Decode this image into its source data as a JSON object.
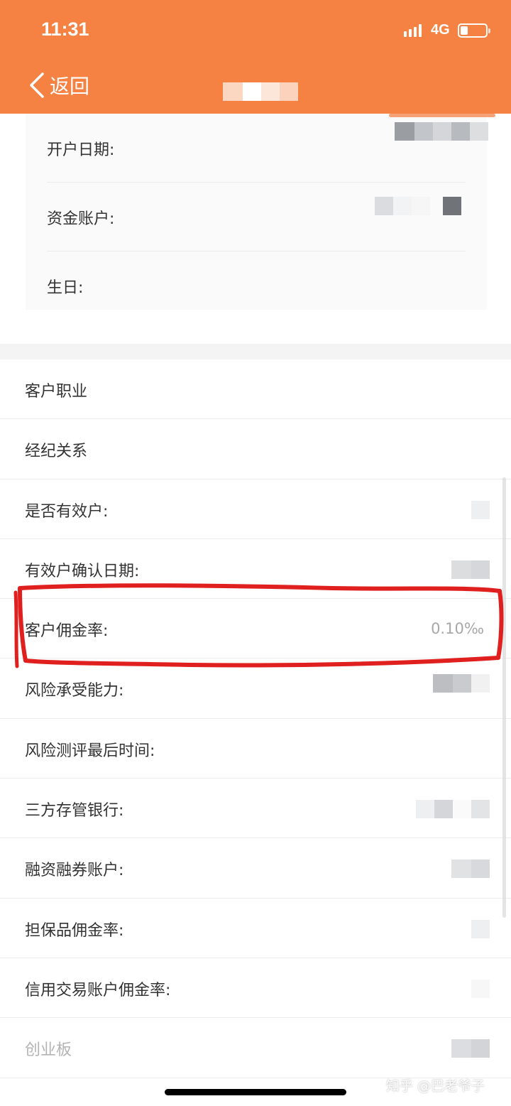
{
  "status_bar": {
    "time": "11:31",
    "network": "4G",
    "battery_percent": 20
  },
  "nav": {
    "back_label": "返回",
    "back_icon": "chevron-left-icon"
  },
  "personal_info": [
    {
      "label": "开户日期:"
    },
    {
      "label": "资金账户:"
    },
    {
      "label": "生日:"
    }
  ],
  "list_items": [
    {
      "label": "客户职业",
      "value": ""
    },
    {
      "label": "经纪关系",
      "value": ""
    },
    {
      "label": "是否有效户:",
      "value": ""
    },
    {
      "label": "有效户确认日期:",
      "value": ""
    },
    {
      "label": "客户佣金率:",
      "value": "0.10‰"
    },
    {
      "label": "风险承受能力:",
      "value": ""
    },
    {
      "label": "风险测评最后时间:",
      "value": ""
    },
    {
      "label": "三方存管银行:",
      "value": ""
    },
    {
      "label": "融资融券账户:",
      "value": ""
    },
    {
      "label": "担保品佣金率:",
      "value": ""
    },
    {
      "label": "信用交易账户佣金率:",
      "value": ""
    },
    {
      "label": "创业板",
      "value": ""
    }
  ],
  "watermark": "知乎 @巴老爷子",
  "colors": {
    "header": "#f58242",
    "annotation": "#e0201e",
    "muted_text": "#b4b4b4"
  }
}
